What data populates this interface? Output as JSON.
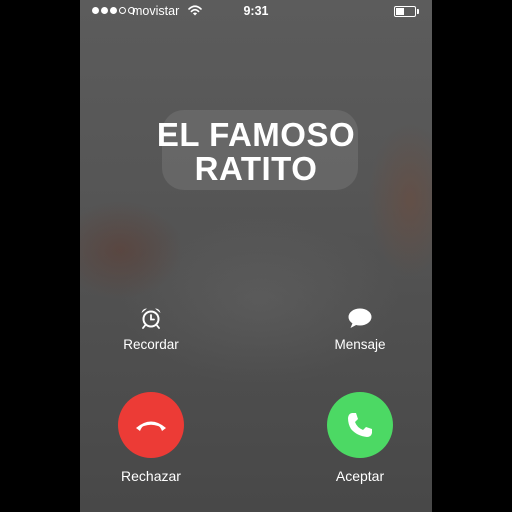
{
  "status_bar": {
    "signal_bars": 3,
    "signal_total": 5,
    "carrier": "movistar",
    "wifi_icon": "wifi-icon",
    "time": "9:31",
    "battery_level": 0.45
  },
  "call": {
    "caller_name_line1": "EL FAMOSO",
    "caller_name_line2": "RATITO"
  },
  "actions": {
    "remind": {
      "label": "Recordar",
      "icon": "alarm-clock-icon"
    },
    "message": {
      "label": "Mensaje",
      "icon": "speech-bubble-icon"
    },
    "decline": {
      "label": "Rechazar",
      "icon": "phone-hangup-icon",
      "color": "#ec3b36"
    },
    "accept": {
      "label": "Aceptar",
      "icon": "phone-icon",
      "color": "#4cd964"
    }
  }
}
